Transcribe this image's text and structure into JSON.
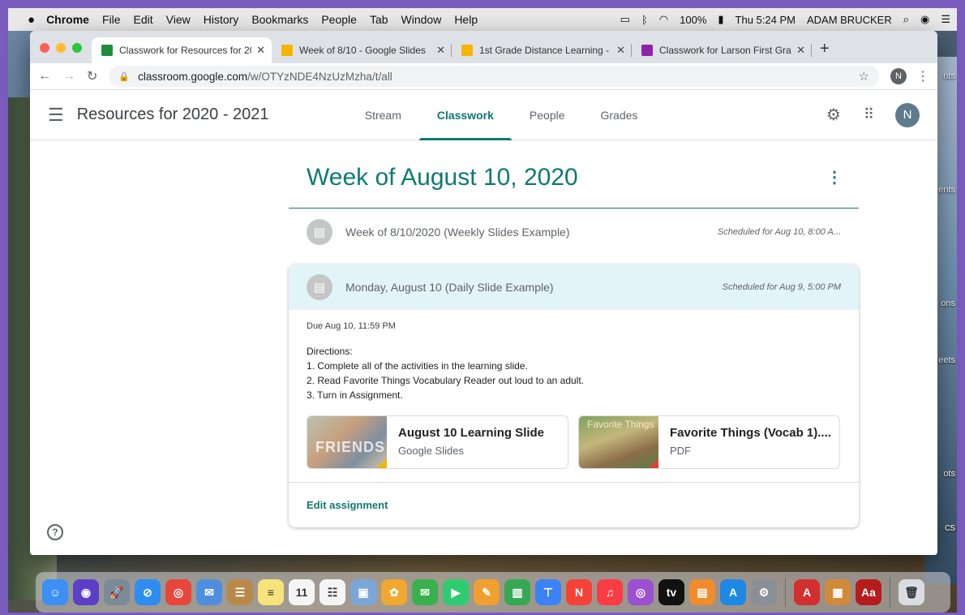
{
  "menubar": {
    "apple": "",
    "app": "Chrome",
    "items": [
      "File",
      "Edit",
      "View",
      "History",
      "Bookmarks",
      "People",
      "Tab",
      "Window",
      "Help"
    ],
    "battery": "100%",
    "clock": "Thu 5:24 PM",
    "user": "ADAM BRUCKER"
  },
  "browser": {
    "tabs": [
      {
        "title": "Classwork for Resources for 20",
        "favicon_color": "#1e8e3e",
        "active": true
      },
      {
        "title": "Week of 8/10 - Google Slides",
        "favicon_color": "#f4b400",
        "active": false
      },
      {
        "title": "1st Grade Distance Learning - ",
        "favicon_color": "#f4b400",
        "active": false
      },
      {
        "title": "Classwork for Larson First Gra",
        "favicon_color": "#8e24aa",
        "active": false
      }
    ],
    "url_host": "classroom.google.com",
    "url_path": "/w/OTYzNDE4NzUzMzha/t/all",
    "profile_initial": "N"
  },
  "classroom": {
    "class_name": "Resources for 2020 - 2021",
    "nav_tabs": [
      {
        "label": "Stream",
        "active": false
      },
      {
        "label": "Classwork",
        "active": true
      },
      {
        "label": "People",
        "active": false
      },
      {
        "label": "Grades",
        "active": false
      }
    ],
    "avatar_initial": "N",
    "accent_color": "#0e7a71",
    "topic": {
      "title": "Week of August 10, 2020",
      "items": [
        {
          "title": "Week of 8/10/2020 (Weekly Slides Example)",
          "schedule": "Scheduled for Aug 10, 8:00 A..."
        }
      ],
      "expanded": {
        "title": "Monday, August 10 (Daily Slide Example)",
        "schedule": "Scheduled for Aug 9, 5:00 PM",
        "due": "Due Aug 10, 11:59 PM",
        "directions": [
          "Directions:",
          "1. Complete all of the activities in the learning slide.",
          "2. Read Favorite Things Vocabulary Reader out loud to an adult.",
          "3. Turn in Assignment."
        ],
        "attachments": [
          {
            "title": "August 10 Learning Slide",
            "type": "Google Slides",
            "thumb_text": "FRIENDS"
          },
          {
            "title": "Favorite Things (Vocab 1)....",
            "type": "PDF",
            "thumb_text": "Favorite Things"
          }
        ],
        "edit_label": "Edit assignment"
      }
    },
    "help_icon": "?"
  },
  "desktop_labels": [
    "nts",
    "ents",
    "ons",
    "eets",
    "ots",
    "cs"
  ],
  "dock": {
    "apps": [
      {
        "name": "finder",
        "color": "#3b8ff5",
        "glyph": "☺"
      },
      {
        "name": "siri",
        "color": "#5b3fc7",
        "glyph": "◉"
      },
      {
        "name": "launchpad",
        "color": "#7b8a99",
        "glyph": "🚀"
      },
      {
        "name": "safari",
        "color": "#2f8cf0",
        "glyph": "⊘"
      },
      {
        "name": "chrome",
        "color": "#e8453c",
        "glyph": "◎"
      },
      {
        "name": "mail",
        "color": "#4e8fdd",
        "glyph": "✉"
      },
      {
        "name": "contacts",
        "color": "#b88a4a",
        "glyph": "☰"
      },
      {
        "name": "notes",
        "color": "#f7e37b",
        "glyph": "≡"
      },
      {
        "name": "calendar",
        "color": "#f5f5f5",
        "glyph": "11"
      },
      {
        "name": "reminders",
        "color": "#f5f5f5",
        "glyph": "☷"
      },
      {
        "name": "preview",
        "color": "#7aa7d8",
        "glyph": "▣"
      },
      {
        "name": "photos",
        "color": "#f0a830",
        "glyph": "✿"
      },
      {
        "name": "messages",
        "color": "#37b24d",
        "glyph": "✉"
      },
      {
        "name": "facetime",
        "color": "#2ecc71",
        "glyph": "▶"
      },
      {
        "name": "pages",
        "color": "#f0a030",
        "glyph": "✎"
      },
      {
        "name": "numbers",
        "color": "#34a853",
        "glyph": "▥"
      },
      {
        "name": "keynote",
        "color": "#3b82f6",
        "glyph": "⊤"
      },
      {
        "name": "news",
        "color": "#f44336",
        "glyph": "N"
      },
      {
        "name": "music",
        "color": "#fc3c44",
        "glyph": "♫"
      },
      {
        "name": "podcasts",
        "color": "#9b4fd1",
        "glyph": "◎"
      },
      {
        "name": "tv",
        "color": "#111111",
        "glyph": "tv"
      },
      {
        "name": "books",
        "color": "#f08c2b",
        "glyph": "▤"
      },
      {
        "name": "app-store",
        "color": "#1e88e5",
        "glyph": "A"
      },
      {
        "name": "system-preferences",
        "color": "#8a8f96",
        "glyph": "⚙"
      },
      {
        "name": "acrobat",
        "color": "#d32f2f",
        "glyph": "A"
      },
      {
        "name": "calculator",
        "color": "#d08a3a",
        "glyph": "▦"
      },
      {
        "name": "dictionary",
        "color": "#b71c1c",
        "glyph": "Aa"
      },
      {
        "name": "trash",
        "color": "#d9dde2",
        "glyph": "🗑"
      }
    ]
  }
}
